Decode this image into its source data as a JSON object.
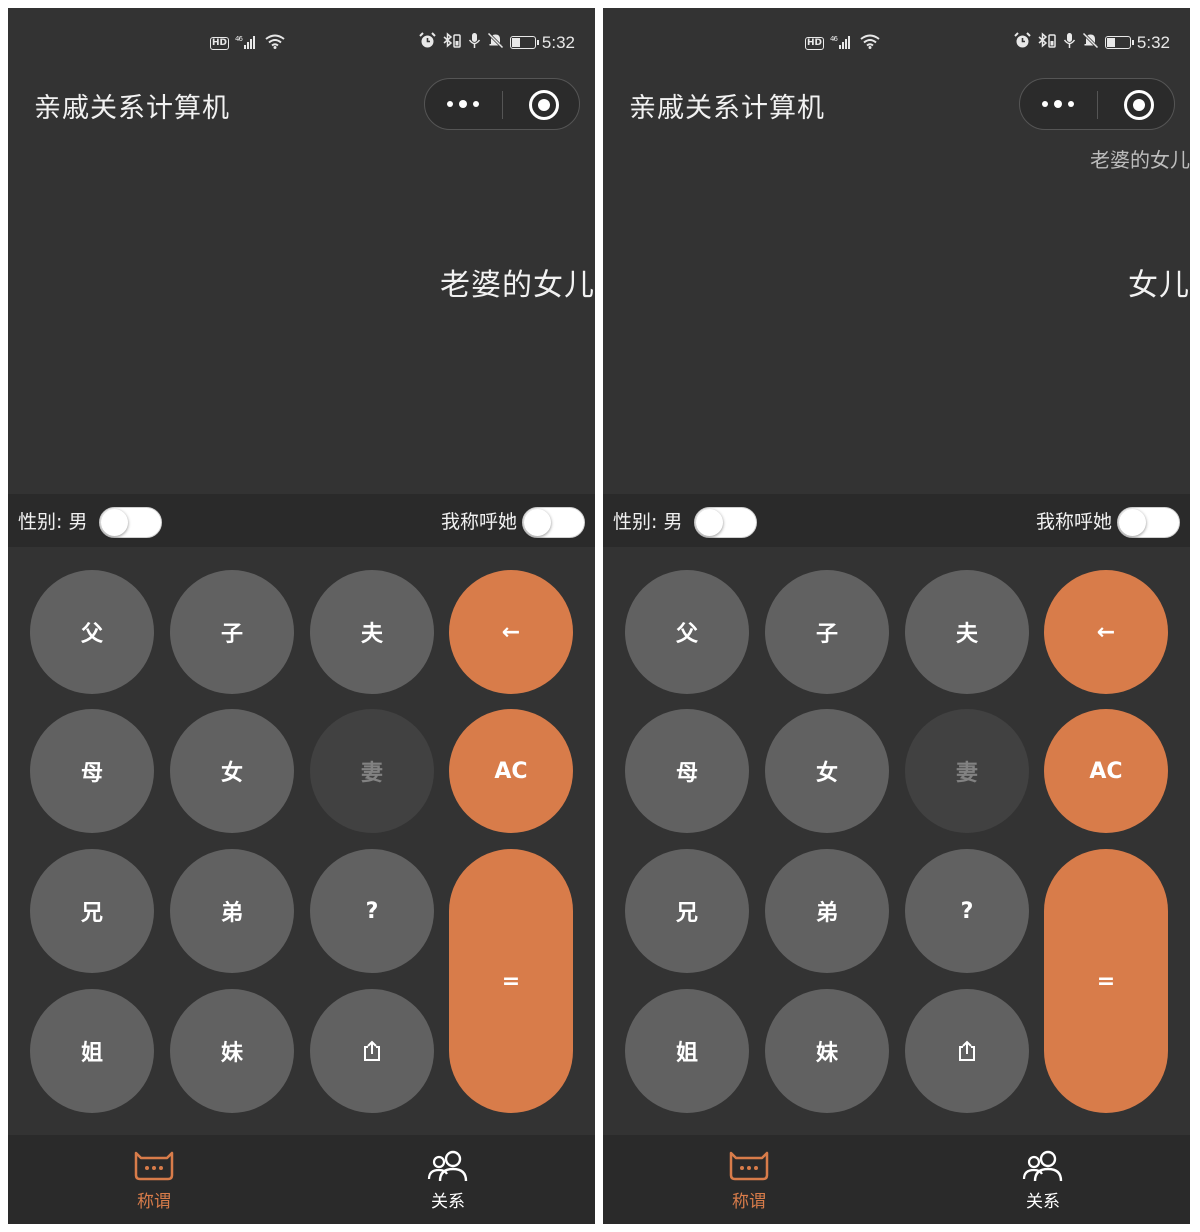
{
  "screens": [
    {
      "status": {
        "hd": "HD",
        "network": "⁴⁶",
        "time": "5:32"
      },
      "app_title": "亲戚关系计算机",
      "display": {
        "history": "",
        "expression": "老婆的女儿"
      },
      "options": {
        "gender_label": "性别: 男",
        "call_label": "我称呼她"
      },
      "keys": {
        "father": "父",
        "son": "子",
        "husband": "夫",
        "backspace": "←",
        "mother": "母",
        "daughter": "女",
        "wife": "妻",
        "clear": "AC",
        "elder_brother": "兄",
        "younger_brother": "弟",
        "question": "?",
        "equals": "=",
        "elder_sister": "姐",
        "younger_sister": "妹"
      },
      "tabs": {
        "appellation": "称谓",
        "relation": "关系"
      }
    },
    {
      "status": {
        "hd": "HD",
        "network": "⁴⁶",
        "time": "5:32"
      },
      "app_title": "亲戚关系计算机",
      "display": {
        "history": "老婆的女儿",
        "expression": "女儿"
      },
      "options": {
        "gender_label": "性别: 男",
        "call_label": "我称呼她"
      },
      "keys": {
        "father": "父",
        "son": "子",
        "husband": "夫",
        "backspace": "←",
        "mother": "母",
        "daughter": "女",
        "wife": "妻",
        "clear": "AC",
        "elder_brother": "兄",
        "younger_brother": "弟",
        "question": "?",
        "equals": "=",
        "elder_sister": "姐",
        "younger_sister": "妹"
      },
      "tabs": {
        "appellation": "称谓",
        "relation": "关系"
      }
    }
  ],
  "icons": {
    "more": "more-dots-icon",
    "target": "target-icon",
    "share": "share-icon",
    "tab_appellation": "chat-bubble-icon",
    "tab_relation": "people-icon"
  },
  "colors": {
    "background": "#333333",
    "bar": "#2a2a2a",
    "key": "#616161",
    "key_disabled": "#414141",
    "accent": "#d87c4a"
  },
  "state": {
    "wife_key_disabled": true,
    "gender_toggle_on": false,
    "call_toggle_on": false,
    "active_tab": "appellation"
  }
}
